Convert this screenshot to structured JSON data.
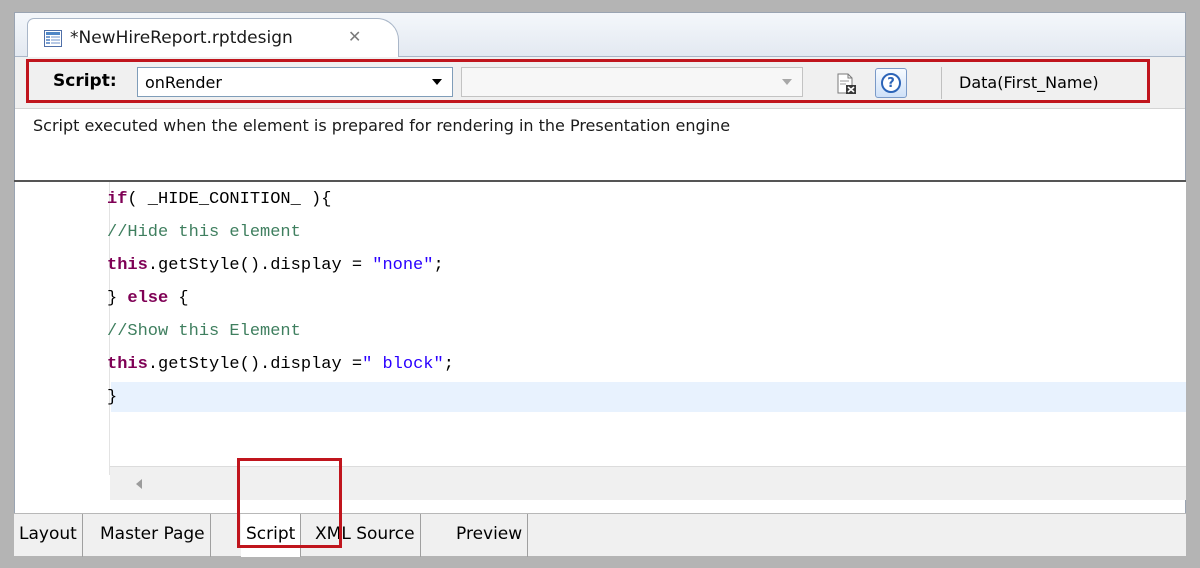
{
  "editor_tab": {
    "title": "*NewHireReport.rptdesign",
    "close_glyph": "✕",
    "icon": "report-design-icon"
  },
  "toolbar": {
    "script_label": "Script:",
    "event_value": "onRender",
    "method_value": "",
    "reset_icon": "reset-script-icon",
    "help_glyph": "?",
    "element_label": "Data(First_Name)"
  },
  "description": "Script executed when the element is prepared for rendering in the Presentation engine",
  "code": {
    "line1": {
      "kw": "if",
      "text": "( _HIDE_CONITION_ ){"
    },
    "line2": {
      "comment": "//Hide this element"
    },
    "line3": {
      "kw": "this",
      "text": ".getStyle().display = ",
      "str": "\"none\"",
      "tail": ";"
    },
    "line4": {
      "text1": "} ",
      "kw": "else",
      "text2": " {"
    },
    "line5": {
      "comment": "//Show this Element"
    },
    "line6": {
      "kw": "this",
      "text": ".getStyle().display =",
      "str": "\" block\"",
      "tail": ";"
    },
    "line7": {
      "text": "}"
    }
  },
  "page_tabs": [
    "Layout",
    "Master Page",
    "Script",
    "XML Source",
    "Preview"
  ],
  "active_tab": "Script",
  "colors": {
    "highlight": "#c0151d",
    "keyword": "#7f0055",
    "string": "#2a00ff",
    "comment": "#3f7f5f"
  }
}
